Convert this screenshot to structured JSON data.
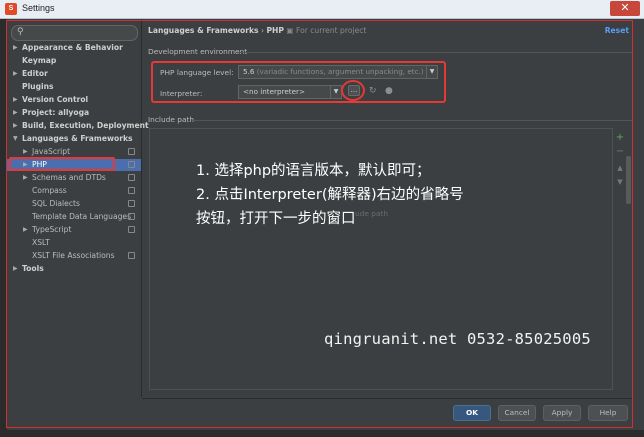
{
  "window": {
    "title": "Settings",
    "app_icon_letter": "S"
  },
  "search": {
    "placeholder": ""
  },
  "sidebar": {
    "items": [
      {
        "label": "Appearance & Behavior",
        "level": 0,
        "arrow": "▶",
        "bold": true
      },
      {
        "label": "Keymap",
        "level": 0,
        "arrow": "",
        "bold": true
      },
      {
        "label": "Editor",
        "level": 0,
        "arrow": "▶",
        "bold": true
      },
      {
        "label": "Plugins",
        "level": 0,
        "arrow": "",
        "bold": true
      },
      {
        "label": "Version Control",
        "level": 0,
        "arrow": "▶",
        "bold": true
      },
      {
        "label": "Project: allyoga",
        "level": 0,
        "arrow": "▶",
        "bold": true
      },
      {
        "label": "Build, Execution, Deployment",
        "level": 0,
        "arrow": "▶",
        "bold": true
      },
      {
        "label": "Languages & Frameworks",
        "level": 0,
        "arrow": "▼",
        "bold": true
      },
      {
        "label": "JavaScript",
        "level": 1,
        "arrow": "▶",
        "badge": true
      },
      {
        "label": "PHP",
        "level": 1,
        "arrow": "▶",
        "badge": true,
        "selected": true
      },
      {
        "label": "Schemas and DTDs",
        "level": 1,
        "arrow": "▶",
        "badge": true
      },
      {
        "label": "Compass",
        "level": 1,
        "arrow": "",
        "badge": true
      },
      {
        "label": "SQL Dialects",
        "level": 1,
        "arrow": "",
        "badge": true
      },
      {
        "label": "Template Data Languages",
        "level": 1,
        "arrow": "",
        "badge": true
      },
      {
        "label": "TypeScript",
        "level": 1,
        "arrow": "▶",
        "badge": true
      },
      {
        "label": "XSLT",
        "level": 1,
        "arrow": ""
      },
      {
        "label": "XSLT File Associations",
        "level": 1,
        "arrow": "",
        "badge": true
      },
      {
        "label": "Tools",
        "level": 0,
        "arrow": "▶",
        "bold": true
      }
    ]
  },
  "main": {
    "breadcrumb_parent": "Languages & Frameworks",
    "breadcrumb_sep": "›",
    "breadcrumb_current": "PHP",
    "breadcrumb_scope": "For current project",
    "reset_label": "Reset",
    "dev_env_label": "Development environment",
    "php_level_label": "PHP language level:",
    "php_level_value": "5.6",
    "php_level_hint": "(variadic functions, argument unpacking, etc.)",
    "interpreter_label": "Interpreter:",
    "interpreter_value": "<no interpreter>",
    "ellipsis_label": "...",
    "include_path_label": "Include path",
    "include_ghost": "ude path"
  },
  "annotation": {
    "line1": "1. 选择php的语言版本，默认即可；",
    "line2": "2. 点击Interpreter(解释器)右边的省略号",
    "line3": "按钮，打开下一步的窗口"
  },
  "watermark": "qingruanit.net 0532-85025005",
  "footer": {
    "ok": "OK",
    "cancel": "Cancel",
    "apply": "Apply",
    "help": "Help"
  },
  "colors": {
    "accent": "#589df6",
    "selection": "#4b6eaf",
    "highlight_red": "#e53935",
    "add_green": "#59a869"
  }
}
